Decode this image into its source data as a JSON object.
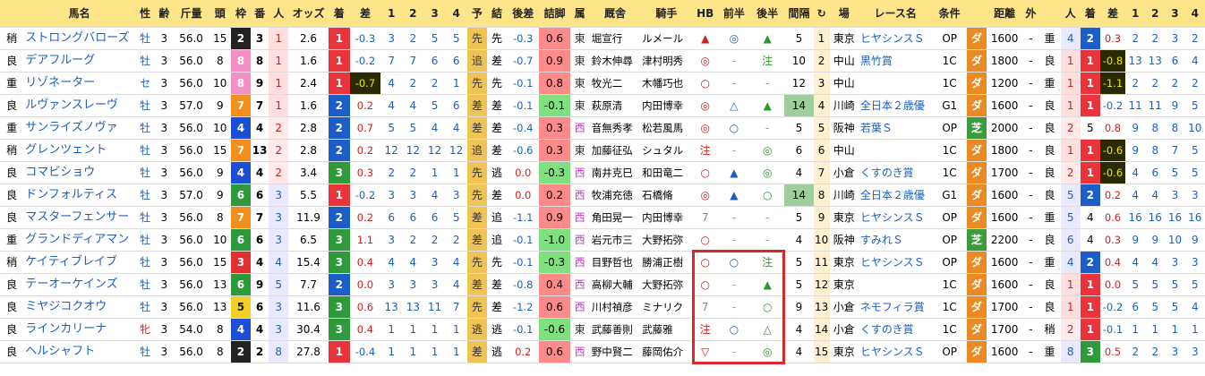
{
  "headers": {
    "c0": "",
    "name": "馬名",
    "sex": "性",
    "age": "齢",
    "wt": "斤量",
    "heads": "頭",
    "waku": "枠",
    "ban": "番",
    "pop": "人",
    "odds": "オッズ",
    "chaku": "着",
    "sa": "差",
    "p1": "1",
    "p2": "2",
    "p3": "3",
    "p4": "4",
    "yo": "予",
    "ket": "結",
    "atoSa": "後差",
    "tsumeAshi": "詰脚",
    "zoku": "属",
    "trainer": "厩舎",
    "jockey": "騎手",
    "hb": "HB",
    "zen": "前半",
    "kou": "後半",
    "interval": "間隔",
    "loop": "↻",
    "place": "場",
    "race": "レース名",
    "cond": "条件",
    "surf": "",
    "dist": "距離",
    "out": "外",
    "c2": "",
    "pop2": "人",
    "chaku2": "着",
    "sa2": "差",
    "q1": "1",
    "q2": "2",
    "q3": "3",
    "q4": "4"
  },
  "rows": [
    {
      "c0": "稍",
      "name": "ストロングバローズ",
      "sex": "牡",
      "age": "3",
      "wt": "56.0",
      "heads": "15",
      "waku": "2",
      "ban": "3",
      "pop": "1",
      "odds": "2.6",
      "chaku": "1",
      "sa": "-0.3",
      "p1": "3",
      "p2": "2",
      "p3": "5",
      "p4": "5",
      "yo": "先",
      "ket": "先",
      "atoSa": "-0.3",
      "tsumeAshi": "0.6",
      "zoku": "東",
      "trainer": "堀宣行",
      "jockey": "ルメール",
      "hb": "▲",
      "zen": "◎",
      "kou": "▲",
      "interval": "5",
      "loop": "1",
      "place": "東京",
      "race": "ヒヤシンスＳ",
      "cond": "OP",
      "surf": "ダ",
      "dist": "1600",
      "out": "-",
      "c2": "重",
      "pop2": "4",
      "chaku2": "2",
      "sa2": "0.3",
      "q1": "2",
      "q2": "2",
      "q3": "3",
      "q4": "2"
    },
    {
      "c0": "良",
      "name": "デアフルーグ",
      "sex": "牡",
      "age": "3",
      "wt": "56.0",
      "heads": "8",
      "waku": "8",
      "ban": "8",
      "pop": "1",
      "odds": "1.6",
      "chaku": "1",
      "sa": "-0.2",
      "p1": "7",
      "p2": "7",
      "p3": "6",
      "p4": "6",
      "yo": "追",
      "ket": "差",
      "atoSa": "-0.7",
      "tsumeAshi": "0.9",
      "zoku": "東",
      "trainer": "鈴木伸尋",
      "jockey": "津村明秀",
      "hb": "◎",
      "zen": "-",
      "kou": "注",
      "interval": "10",
      "loop": "2",
      "place": "中山",
      "race": "黒竹賞",
      "cond": "1C",
      "surf": "ダ",
      "dist": "1800",
      "out": "-",
      "c2": "良",
      "pop2": "1",
      "chaku2": "1",
      "sa2": "-0.8",
      "q1": "13",
      "q2": "13",
      "q3": "6",
      "q4": "4"
    },
    {
      "c0": "重",
      "name": "リゾネーター",
      "sex": "セ",
      "age": "3",
      "wt": "56.0",
      "heads": "10",
      "waku": "8",
      "ban": "9",
      "pop": "1",
      "odds": "2.4",
      "chaku": "1",
      "sa": "-0.7",
      "p1": "4",
      "p2": "2",
      "p3": "2",
      "p4": "1",
      "yo": "先",
      "ket": "先",
      "atoSa": "-0.1",
      "tsumeAshi": "0.8",
      "zoku": "東",
      "trainer": "牧光二",
      "jockey": "木幡巧也",
      "hb": "○",
      "zen": "-",
      "kou": "-",
      "interval": "12",
      "loop": "3",
      "place": "中山",
      "race": "",
      "cond": "1C",
      "surf": "ダ",
      "dist": "1200",
      "out": "-",
      "c2": "重",
      "pop2": "1",
      "chaku2": "1",
      "sa2": "-1.1",
      "q1": "2",
      "q2": "2",
      "q3": "2",
      "q4": "2"
    },
    {
      "c0": "良",
      "name": "ルヴァンスレーヴ",
      "sex": "牡",
      "age": "3",
      "wt": "57.0",
      "heads": "9",
      "waku": "7",
      "ban": "7",
      "pop": "1",
      "odds": "1.6",
      "chaku": "2",
      "sa": "0.2",
      "p1": "4",
      "p2": "4",
      "p3": "5",
      "p4": "6",
      "yo": "差",
      "ket": "差",
      "atoSa": "-0.1",
      "tsumeAshi": "-0.1",
      "zoku": "東",
      "trainer": "萩原清",
      "jockey": "内田博幸",
      "hb": "◎",
      "zen": "△",
      "kou": "▲",
      "interval": "14",
      "loop": "4",
      "place": "川崎",
      "race": "全日本２歳優",
      "cond": "G1",
      "surf": "ダ",
      "dist": "1600",
      "out": "-",
      "c2": "良",
      "pop2": "1",
      "chaku2": "1",
      "sa2": "-0.2",
      "q1": "11",
      "q2": "11",
      "q3": "9",
      "q4": "5"
    },
    {
      "c0": "重",
      "name": "サンライズノヴァ",
      "sex": "牡",
      "age": "3",
      "wt": "56.0",
      "heads": "10",
      "waku": "4",
      "ban": "4",
      "pop": "2",
      "odds": "2.8",
      "chaku": "2",
      "sa": "0.7",
      "p1": "5",
      "p2": "5",
      "p3": "4",
      "p4": "4",
      "yo": "差",
      "ket": "差",
      "atoSa": "-0.4",
      "tsumeAshi": "0.3",
      "zoku": "西",
      "trainer": "音無秀孝",
      "jockey": "松若風馬",
      "hb": "◎",
      "zen": "○",
      "kou": "-",
      "interval": "5",
      "loop": "5",
      "place": "阪神",
      "race": "若葉Ｓ",
      "cond": "OP",
      "surf": "芝",
      "dist": "2000",
      "out": "-",
      "c2": "良",
      "pop2": "2",
      "chaku2": "5",
      "sa2": "0.8",
      "q1": "9",
      "q2": "8",
      "q3": "8",
      "q4": "10"
    },
    {
      "c0": "稍",
      "name": "グレンツェント",
      "sex": "牡",
      "age": "3",
      "wt": "56.0",
      "heads": "15",
      "waku": "7",
      "ban": "13",
      "pop": "2",
      "odds": "2.8",
      "chaku": "2",
      "sa": "0.2",
      "p1": "12",
      "p2": "12",
      "p3": "12",
      "p4": "12",
      "yo": "追",
      "ket": "差",
      "atoSa": "-0.6",
      "tsumeAshi": "0.3",
      "zoku": "東",
      "trainer": "加藤征弘",
      "jockey": "シュタル",
      "hb": "注",
      "zen": "-",
      "kou": "◎",
      "interval": "6",
      "loop": "6",
      "place": "中山",
      "race": "",
      "cond": "1C",
      "surf": "ダ",
      "dist": "1800",
      "out": "-",
      "c2": "良",
      "pop2": "1",
      "chaku2": "1",
      "sa2": "-0.6",
      "q1": "9",
      "q2": "8",
      "q3": "7",
      "q4": "5"
    },
    {
      "c0": "良",
      "name": "コマビショウ",
      "sex": "牡",
      "age": "3",
      "wt": "56.0",
      "heads": "9",
      "waku": "4",
      "ban": "4",
      "pop": "2",
      "odds": "3.4",
      "chaku": "3",
      "sa": "0.3",
      "p1": "2",
      "p2": "2",
      "p3": "1",
      "p4": "1",
      "yo": "先",
      "ket": "逃",
      "atoSa": "0.0",
      "tsumeAshi": "-0.3",
      "zoku": "西",
      "trainer": "南井克巳",
      "jockey": "和田竜二",
      "hb": "○",
      "zen": "▲",
      "kou": "◎",
      "interval": "4",
      "loop": "7",
      "place": "小倉",
      "race": "くすのき賞",
      "cond": "1C",
      "surf": "ダ",
      "dist": "1700",
      "out": "-",
      "c2": "良",
      "pop2": "2",
      "chaku2": "1",
      "sa2": "-0.6",
      "q1": "4",
      "q2": "6",
      "q3": "5",
      "q4": "5"
    },
    {
      "c0": "良",
      "name": "ドンフォルティス",
      "sex": "牡",
      "age": "3",
      "wt": "57.0",
      "heads": "9",
      "waku": "6",
      "ban": "6",
      "pop": "3",
      "odds": "5.5",
      "chaku": "1",
      "sa": "-0.2",
      "p1": "3",
      "p2": "3",
      "p3": "4",
      "p4": "3",
      "yo": "先",
      "ket": "差",
      "atoSa": "0.0",
      "tsumeAshi": "0.2",
      "zoku": "西",
      "trainer": "牧浦充徳",
      "jockey": "石橋脩",
      "hb": "◎",
      "zen": "▲",
      "kou": "○",
      "interval": "14",
      "loop": "8",
      "place": "川崎",
      "race": "全日本２歳優",
      "cond": "G1",
      "surf": "ダ",
      "dist": "1600",
      "out": "-",
      "c2": "良",
      "pop2": "5",
      "chaku2": "2",
      "sa2": "0.2",
      "q1": "4",
      "q2": "4",
      "q3": "3",
      "q4": "3"
    },
    {
      "c0": "良",
      "name": "マスターフェンサー",
      "sex": "牡",
      "age": "3",
      "wt": "56.0",
      "heads": "8",
      "waku": "7",
      "ban": "7",
      "pop": "3",
      "odds": "11.9",
      "chaku": "2",
      "sa": "0.2",
      "p1": "6",
      "p2": "6",
      "p3": "6",
      "p4": "5",
      "yo": "差",
      "ket": "追",
      "atoSa": "-1.1",
      "tsumeAshi": "0.9",
      "zoku": "西",
      "trainer": "角田晃一",
      "jockey": "内田博幸",
      "hb": "7",
      "zen": "-",
      "kou": "-",
      "interval": "5",
      "loop": "9",
      "place": "東京",
      "race": "ヒヤシンスＳ",
      "cond": "OP",
      "surf": "ダ",
      "dist": "1600",
      "out": "-",
      "c2": "重",
      "pop2": "5",
      "chaku2": "4",
      "sa2": "0.6",
      "q1": "16",
      "q2": "16",
      "q3": "16",
      "q4": "16"
    },
    {
      "c0": "重",
      "name": "グランドディアマン",
      "sex": "牡",
      "age": "3",
      "wt": "56.0",
      "heads": "10",
      "waku": "6",
      "ban": "6",
      "pop": "3",
      "odds": "6.5",
      "chaku": "3",
      "sa": "1.1",
      "p1": "3",
      "p2": "2",
      "p3": "2",
      "p4": "2",
      "yo": "差",
      "ket": "追",
      "atoSa": "-0.1",
      "tsumeAshi": "-1.0",
      "zoku": "西",
      "trainer": "岩元市三",
      "jockey": "大野拓弥",
      "hb": "○",
      "zen": "-",
      "kou": "-",
      "interval": "4",
      "loop": "10",
      "place": "阪神",
      "race": "すみれＳ",
      "cond": "OP",
      "surf": "芝",
      "dist": "2200",
      "out": "-",
      "c2": "良",
      "pop2": "6",
      "chaku2": "4",
      "sa2": "0.3",
      "q1": "9",
      "q2": "9",
      "q3": "10",
      "q4": "9"
    },
    {
      "c0": "稍",
      "name": "ケイティブレイブ",
      "sex": "牡",
      "age": "3",
      "wt": "56.0",
      "heads": "15",
      "waku": "3",
      "ban": "4",
      "pop": "4",
      "odds": "15.4",
      "chaku": "3",
      "sa": "0.4",
      "p1": "4",
      "p2": "4",
      "p3": "3",
      "p4": "4",
      "yo": "先",
      "ket": "先",
      "atoSa": "-0.1",
      "tsumeAshi": "-0.3",
      "zoku": "西",
      "trainer": "目野哲也",
      "jockey": "勝浦正樹",
      "hb": "○",
      "zen": "○",
      "kou": "注",
      "interval": "5",
      "loop": "11",
      "place": "東京",
      "race": "ヒヤシンスＳ",
      "cond": "OP",
      "surf": "ダ",
      "dist": "1600",
      "out": "-",
      "c2": "重",
      "pop2": "4",
      "chaku2": "2",
      "sa2": "0.4",
      "q1": "4",
      "q2": "4",
      "q3": "3",
      "q4": "3"
    },
    {
      "c0": "良",
      "name": "テーオーケインズ",
      "sex": "牡",
      "age": "3",
      "wt": "56.0",
      "heads": "13",
      "waku": "6",
      "ban": "9",
      "pop": "5",
      "odds": "7.7",
      "chaku": "2",
      "sa": "0.0",
      "p1": "3",
      "p2": "3",
      "p3": "3",
      "p4": "4",
      "yo": "差",
      "ket": "差",
      "atoSa": "-0.8",
      "tsumeAshi": "0.4",
      "zoku": "西",
      "trainer": "高柳大輔",
      "jockey": "大野拓弥",
      "hb": "○",
      "zen": "-",
      "kou": "▲",
      "interval": "5",
      "loop": "12",
      "place": "東京",
      "race": "",
      "cond": "1C",
      "surf": "ダ",
      "dist": "1600",
      "out": "-",
      "c2": "良",
      "pop2": "1",
      "chaku2": "1",
      "sa2": "0.0",
      "q1": "5",
      "q2": "5",
      "q3": "5",
      "q4": "5"
    },
    {
      "c0": "良",
      "name": "ミヤジコクオウ",
      "sex": "牡",
      "age": "3",
      "wt": "56.0",
      "heads": "13",
      "waku": "5",
      "ban": "6",
      "pop": "3",
      "odds": "11.6",
      "chaku": "3",
      "sa": "0.6",
      "p1": "13",
      "p2": "13",
      "p3": "11",
      "p4": "7",
      "yo": "先",
      "ket": "差",
      "atoSa": "-1.2",
      "tsumeAshi": "0.6",
      "zoku": "西",
      "trainer": "川村禎彦",
      "jockey": "ミナリク",
      "hb": "7",
      "zen": "-",
      "kou": "○",
      "interval": "9",
      "loop": "13",
      "place": "小倉",
      "race": "ネモフィラ賞",
      "cond": "1C",
      "surf": "ダ",
      "dist": "1700",
      "out": "-",
      "c2": "良",
      "pop2": "1",
      "chaku2": "1",
      "sa2": "-0.2",
      "q1": "6",
      "q2": "5",
      "q3": "5",
      "q4": "4"
    },
    {
      "c0": "良",
      "name": "ラインカリーナ",
      "sex": "牝",
      "age": "3",
      "wt": "54.0",
      "heads": "8",
      "waku": "4",
      "ban": "4",
      "pop": "3",
      "odds": "30.4",
      "chaku": "3",
      "sa": "0.4",
      "p1": "1",
      "p2": "1",
      "p3": "1",
      "p4": "1",
      "yo": "逃",
      "ket": "逃",
      "atoSa": "-0.1",
      "tsumeAshi": "-0.6",
      "zoku": "東",
      "trainer": "武藤善則",
      "jockey": "武藤雅",
      "hb": "注",
      "zen": "○",
      "kou": "△",
      "interval": "4",
      "loop": "14",
      "place": "小倉",
      "race": "くすのき賞",
      "cond": "1C",
      "surf": "ダ",
      "dist": "1700",
      "out": "-",
      "c2": "稍",
      "pop2": "2",
      "chaku2": "1",
      "sa2": "-0.1",
      "q1": "1",
      "q2": "1",
      "q3": "1",
      "q4": "1"
    },
    {
      "c0": "良",
      "name": "ヘルシャフト",
      "sex": "牡",
      "age": "3",
      "wt": "56.0",
      "heads": "8",
      "waku": "2",
      "ban": "2",
      "pop": "8",
      "odds": "27.8",
      "chaku": "1",
      "sa": "-0.4",
      "p1": "1",
      "p2": "1",
      "p3": "1",
      "p4": "1",
      "yo": "差",
      "ket": "逃",
      "atoSa": "0.2",
      "tsumeAshi": "0.6",
      "zoku": "西",
      "trainer": "野中賢二",
      "jockey": "藤岡佑介",
      "hb": "▽",
      "zen": "-",
      "kou": "◎",
      "interval": "4",
      "loop": "15",
      "place": "東京",
      "race": "ヒヤシンスＳ",
      "cond": "OP",
      "surf": "ダ",
      "dist": "1600",
      "out": "-",
      "c2": "重",
      "pop2": "8",
      "chaku2": "3",
      "sa2": "0.5",
      "q1": "2",
      "q2": "2",
      "q3": "3",
      "q4": "3"
    }
  ],
  "colors": {
    "header": "#ffe58a",
    "waku": [
      "#ffffff",
      "#ffffff",
      "#222222",
      "#e03030",
      "#1c4fd6",
      "#f2cf25",
      "#2c9a3a",
      "#f28f1c",
      "#f58fc4"
    ],
    "pop_fill": [
      "#fff0f0",
      "#ff9999",
      "#d8d8f8"
    ],
    "chaku": {
      "1": "#e8343a",
      "2": "#1c5ec8",
      "3": "#2e9a3a"
    },
    "yo": "#f0c454",
    "tsume": {
      "red": "#ff8a8a",
      "green": "#7fe07f"
    },
    "surf": {
      "ダ": "#e98a25",
      "芝": "#3c9b3a"
    },
    "interval_hl": "#9ccf9c",
    "highlight_box": "#e0242a"
  }
}
